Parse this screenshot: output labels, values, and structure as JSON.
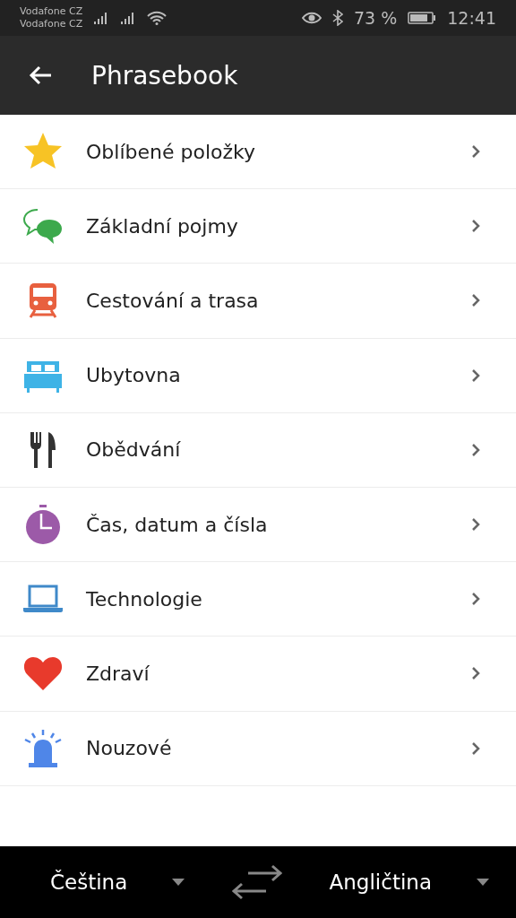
{
  "status_bar": {
    "carriers": [
      "Vodafone CZ",
      "Vodafone CZ"
    ],
    "battery": "73 %",
    "time": "12:41"
  },
  "header": {
    "title": "Phrasebook"
  },
  "categories": [
    {
      "label": "Oblíbené položky",
      "kind": "star"
    },
    {
      "label": "Základní pojmy",
      "kind": "chat"
    },
    {
      "label": "Cestování a trasa",
      "kind": "train"
    },
    {
      "label": "Ubytovna",
      "kind": "bed"
    },
    {
      "label": "Obědvání",
      "kind": "cutlery"
    },
    {
      "label": "Čas, datum a čísla",
      "kind": "timer"
    },
    {
      "label": "Technologie",
      "kind": "laptop"
    },
    {
      "label": "Zdraví",
      "kind": "heart"
    },
    {
      "label": "Nouzové",
      "kind": "siren"
    }
  ],
  "language_bar": {
    "source": "Čeština",
    "target": "Angličtina"
  }
}
